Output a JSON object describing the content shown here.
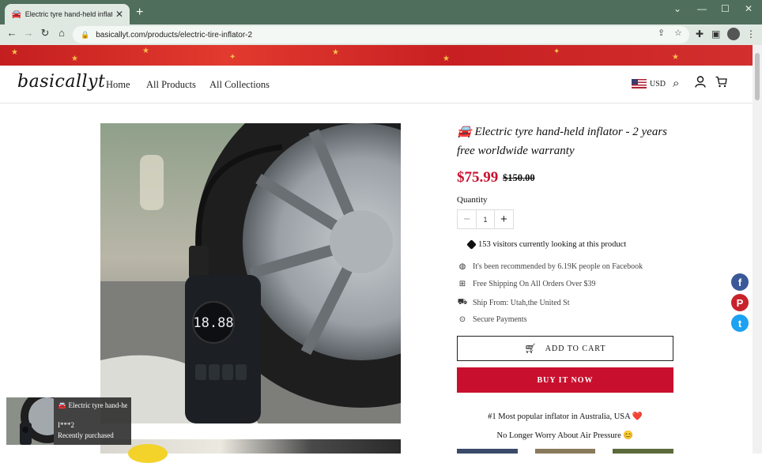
{
  "browser": {
    "tab_title": "Electric tyre hand-held inflator",
    "tab_favicon": "🚘",
    "url": "basicallyt.com/products/electric-tire-inflator-2",
    "colors": {
      "frame": "#4f6f5c",
      "toolbar": "#dfe9e2"
    }
  },
  "store": {
    "logo": "basicallyt",
    "nav": [
      "Home",
      "All Products",
      "All Collections"
    ],
    "currency": "USD"
  },
  "product": {
    "title_emoji": "🚘",
    "title": "Electric tyre hand-held inflator - 2 years free worldwide warranty",
    "price": "$75.99",
    "compare_price": "$150.00",
    "quantity_label": "Quantity",
    "quantity": "1",
    "visitors": "153 visitors currently looking at this product",
    "features": [
      {
        "icon": "globe-icon",
        "text": "It's been recommended by 6.19K people on Facebook"
      },
      {
        "icon": "gift-icon",
        "text": "Free Shipping On All Orders Over $39"
      },
      {
        "icon": "truck-icon",
        "text": "Ship From: Utah,the United St"
      },
      {
        "icon": "lock-icon",
        "text": "Secure Payments"
      }
    ],
    "add_to_cart": "ADD TO CART",
    "buy_now": "BUY IT NOW",
    "promo_1": "#1 Most popular inflator in Australia, USA ❤️",
    "promo_2": "No Longer Worry About Air Pressure 😊",
    "device_display": "18.88"
  },
  "toast": {
    "title": "🚘 Electric tyre hand-held inflator",
    "buyer": "I***2",
    "status": "Recently purchased"
  },
  "social": [
    "facebook-icon",
    "pinterest-icon",
    "twitter-icon"
  ],
  "colors": {
    "accent": "#c8102e",
    "banner": "#c41e20",
    "facebook": "#3b5998",
    "pinterest": "#c8232c",
    "twitter": "#1da1f2"
  }
}
